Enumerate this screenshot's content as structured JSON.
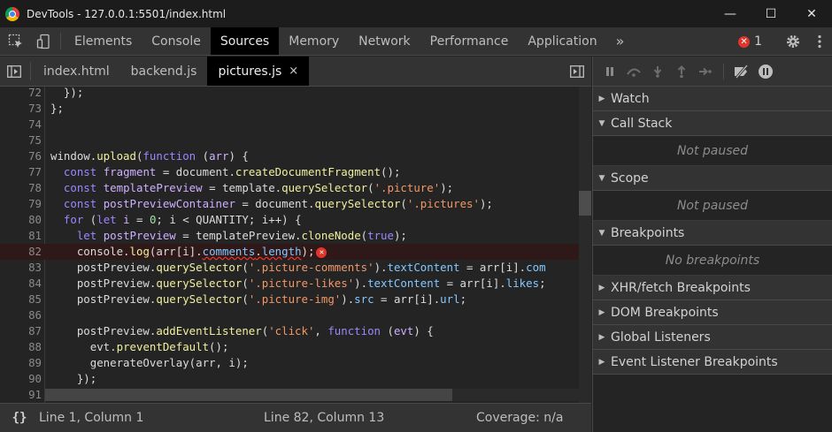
{
  "window": {
    "title": "DevTools - 127.0.0.1:5501/index.html",
    "minimize": "—",
    "maximize": "☐",
    "close": "✕"
  },
  "main_tabs": [
    {
      "label": "Elements",
      "active": false
    },
    {
      "label": "Console",
      "active": false
    },
    {
      "label": "Sources",
      "active": true
    },
    {
      "label": "Memory",
      "active": false
    },
    {
      "label": "Network",
      "active": false
    },
    {
      "label": "Performance",
      "active": false
    },
    {
      "label": "Application",
      "active": false
    }
  ],
  "more_tabs": "»",
  "error_count": "1",
  "file_tabs": [
    {
      "label": "index.html",
      "active": false
    },
    {
      "label": "backend.js",
      "active": false
    },
    {
      "label": "pictures.js",
      "active": true,
      "close": "×"
    }
  ],
  "code": {
    "lines": [
      {
        "n": "72",
        "html": "  });"
      },
      {
        "n": "73",
        "html": "};"
      },
      {
        "n": "74",
        "html": ""
      },
      {
        "n": "75",
        "html": ""
      },
      {
        "n": "76",
        "html": "window.<span class=\"fn\">upload</span>(<span class=\"kw\">function</span> (<span class=\"vr\">arr</span>) {"
      },
      {
        "n": "77",
        "html": "  <span class=\"kw\">const</span> <span class=\"vr\">fragment</span> = document.<span class=\"fn\">createDocumentFragment</span>();"
      },
      {
        "n": "78",
        "html": "  <span class=\"kw\">const</span> <span class=\"vr\">templatePreview</span> = template.<span class=\"fn\">querySelector</span>(<span class=\"st\">'.picture'</span>);"
      },
      {
        "n": "79",
        "html": "  <span class=\"kw\">const</span> <span class=\"vr\">postPreviewContainer</span> = document.<span class=\"fn\">querySelector</span>(<span class=\"st\">'.pictures'</span>);"
      },
      {
        "n": "80",
        "html": "  <span class=\"kw\">for</span> (<span class=\"kw\">let</span> <span class=\"vr\">i</span> = <span class=\"nm\">0</span>; i &lt; QUANTITY; i++) {"
      },
      {
        "n": "81",
        "html": "    <span class=\"kw\">let</span> <span class=\"vr\">postPreview</span> = templatePreview.<span class=\"fn\">cloneNode</span>(<span class=\"bool\">true</span>);"
      },
      {
        "n": "82",
        "html": "    console.<span class=\"fn\">log</span>(arr[i].<span class=\"underline\"><span class=\"pr\">comments</span>.<span class=\"pr\">length</span></span>);<span class=\"inline-err\">✕</span>",
        "error": true
      },
      {
        "n": "83",
        "html": "    postPreview.<span class=\"fn\">querySelector</span>(<span class=\"st\">'.picture-comments'</span>).<span class=\"pr\">textContent</span> = arr[i].<span class=\"pr\">com</span>"
      },
      {
        "n": "84",
        "html": "    postPreview.<span class=\"fn\">querySelector</span>(<span class=\"st\">'.picture-likes'</span>).<span class=\"pr\">textContent</span> = arr[i].<span class=\"pr\">likes</span>;"
      },
      {
        "n": "85",
        "html": "    postPreview.<span class=\"fn\">querySelector</span>(<span class=\"st\">'.picture-img'</span>).<span class=\"pr\">src</span> = arr[i].<span class=\"pr\">url</span>;"
      },
      {
        "n": "86",
        "html": ""
      },
      {
        "n": "87",
        "html": "    postPreview.<span class=\"fn\">addEventListener</span>(<span class=\"st\">'click'</span>, <span class=\"kw\">function</span> (<span class=\"vr\">evt</span>) {"
      },
      {
        "n": "88",
        "html": "      evt.<span class=\"fn\">preventDefault</span>();"
      },
      {
        "n": "89",
        "html": "      generateOverlay(arr, i);"
      },
      {
        "n": "90",
        "html": "    });"
      },
      {
        "n": "91",
        "html": ""
      }
    ]
  },
  "status": {
    "braces": "{}",
    "cursor": "Line 1, Column 1",
    "error_pos": "Line 82, Column 13",
    "coverage": "Coverage: n/a"
  },
  "sidebar": {
    "sections": [
      {
        "title": "Watch",
        "body": null
      },
      {
        "title": "Call Stack",
        "body": "Not paused"
      },
      {
        "title": "Scope",
        "body": "Not paused"
      },
      {
        "title": "Breakpoints",
        "body": "No breakpoints"
      },
      {
        "title": "XHR/fetch Breakpoints",
        "body": null
      },
      {
        "title": "DOM Breakpoints",
        "body": null
      },
      {
        "title": "Global Listeners",
        "body": null
      },
      {
        "title": "Event Listener Breakpoints",
        "body": null
      }
    ]
  },
  "colors": {
    "accent_error": "#e0352b",
    "panel_bg": "#333333",
    "editor_bg": "#242424"
  }
}
